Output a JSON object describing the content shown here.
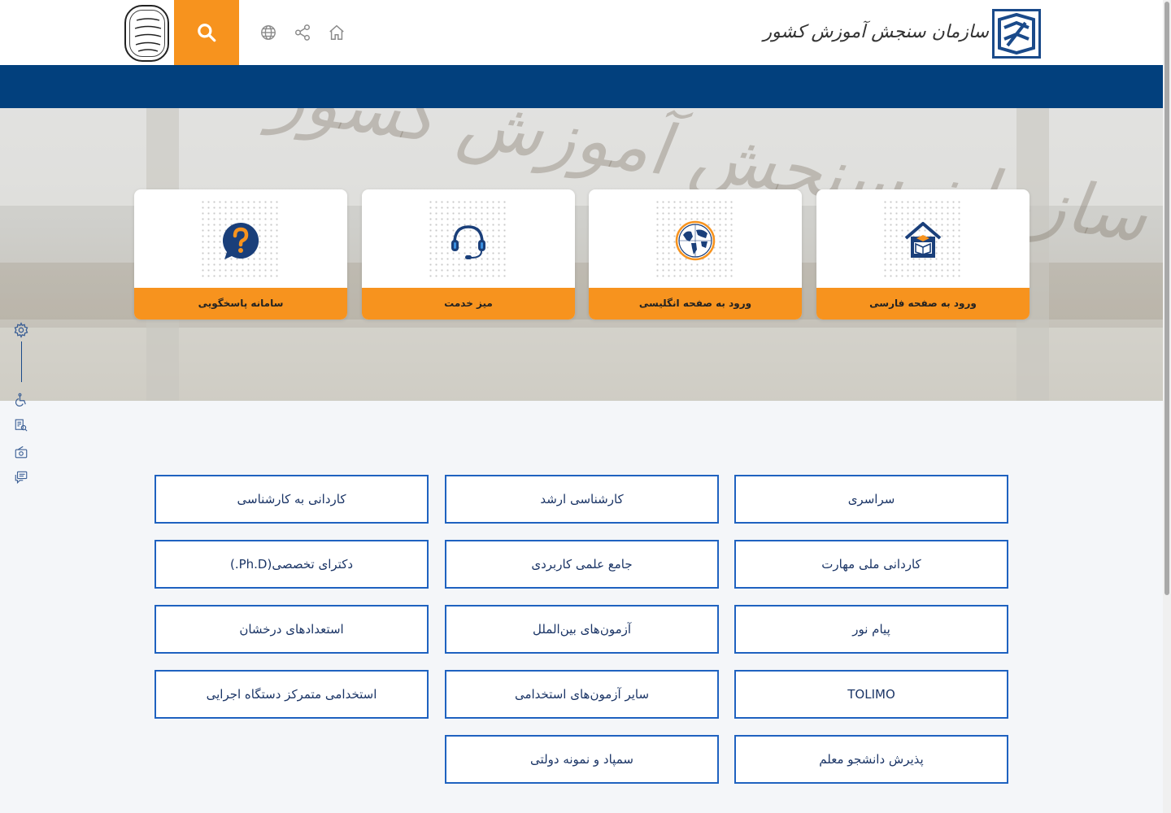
{
  "header": {
    "brand_text": "سازمان سنجش آموزش کشور",
    "search_icon": "search-icon",
    "icons": [
      "globe-icon",
      "share-icon",
      "home-icon"
    ]
  },
  "hero": {
    "cards": [
      {
        "label": "ورود به صفحه فارسی",
        "icon": "house-graduation-icon"
      },
      {
        "label": "ورود به صفحه انگلیسی",
        "icon": "globe-world-icon"
      },
      {
        "label": "میز خدمت",
        "icon": "headset-icon"
      },
      {
        "label": "سامانه پاسخگویی",
        "icon": "question-bubble-icon"
      }
    ]
  },
  "sidebar": {
    "icons": [
      "settings-icon",
      "wheelchair-icon",
      "document-search-icon",
      "radio-icon",
      "chat-icon"
    ]
  },
  "exams": {
    "buttons": [
      "سراسری",
      "کارشناسی ارشد",
      "کاردانی به کارشناسی",
      "کاردانی ملی مهارت",
      "جامع علمی کاربردی",
      "دکترای تخصصی(Ph.D.)",
      "پیام نور",
      "آزمون‌های بین‌الملل",
      "استعدادهای درخشان",
      "TOLIMO",
      "سایر آزمون‌های استخدامی",
      "استخدامی متمرکز دستگاه اجرایی",
      "پذیرش دانشجو معلم",
      "سمپاد و نمونه دولتی"
    ]
  },
  "colors": {
    "navy": "#02407d",
    "orange": "#f7931e",
    "button_border": "#1f62c0"
  }
}
